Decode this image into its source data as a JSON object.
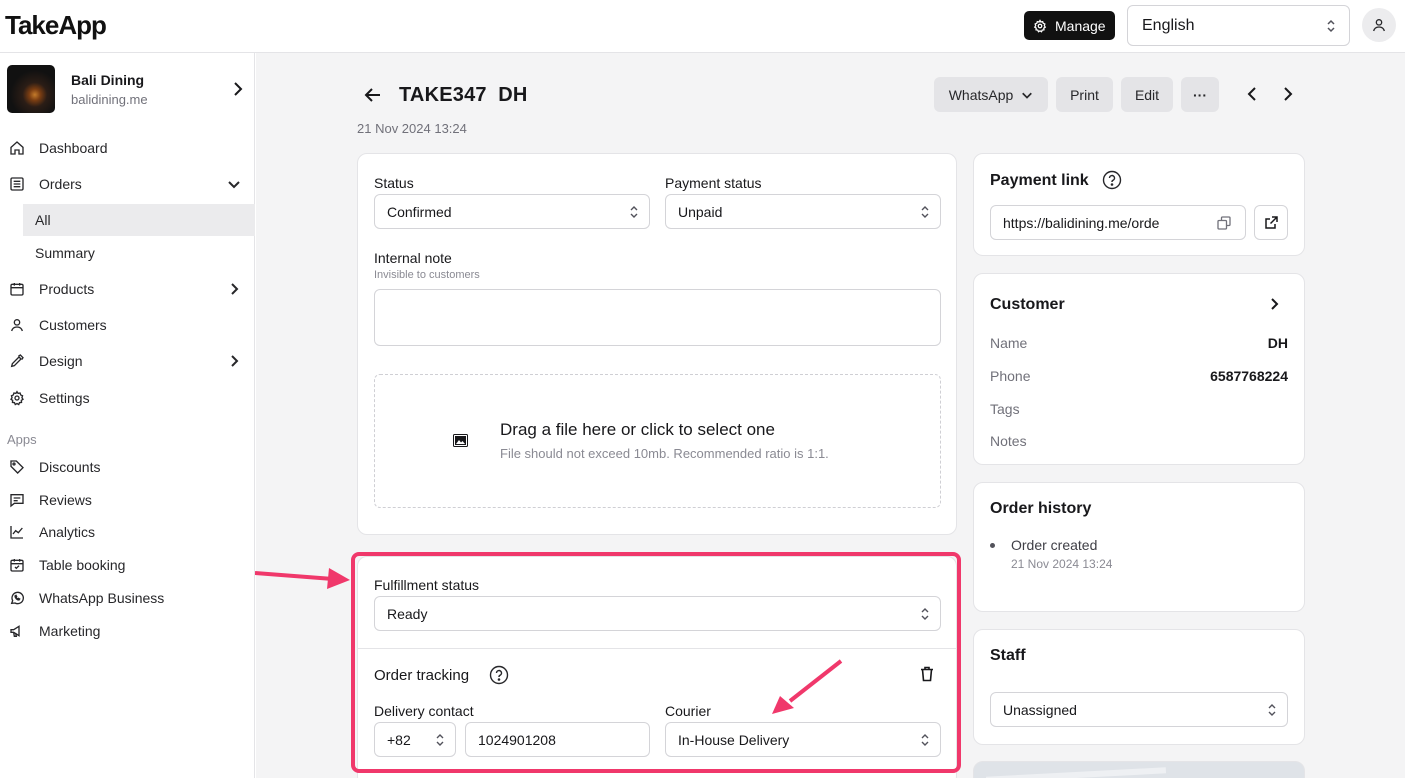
{
  "topbar": {
    "logo": "TakeApp",
    "manage_label": "Manage",
    "language": "English"
  },
  "sidebar": {
    "store_name": "Bali Dining",
    "store_domain": "balidining.me",
    "items": {
      "dashboard": "Dashboard",
      "orders": "Orders",
      "orders_all": "All",
      "orders_summary": "Summary",
      "products": "Products",
      "customers": "Customers",
      "design": "Design",
      "settings": "Settings"
    },
    "apps_label": "Apps",
    "apps": {
      "discounts": "Discounts",
      "reviews": "Reviews",
      "analytics": "Analytics",
      "table_booking": "Table booking",
      "whatsapp_business": "WhatsApp Business",
      "marketing": "Marketing"
    }
  },
  "order": {
    "id": "TAKE347",
    "customer_code": "DH",
    "date": "21 Nov 2024 13:24",
    "toolbar": {
      "whatsapp": "WhatsApp",
      "print": "Print",
      "edit": "Edit",
      "more": "···"
    }
  },
  "status_card": {
    "status_label": "Status",
    "status_value": "Confirmed",
    "payment_label": "Payment status",
    "payment_value": "Unpaid",
    "note_label": "Internal note",
    "note_hint": "Invisible to customers",
    "dropzone_title": "Drag a file here or click to select one",
    "dropzone_hint": "File should not exceed 10mb. Recommended ratio is 1:1."
  },
  "fulfillment_card": {
    "fulfillment_label": "Fulfillment status",
    "fulfillment_value": "Ready",
    "tracking_label": "Order tracking",
    "delivery_contact_label": "Delivery contact",
    "country_code": "+82",
    "phone": "1024901208",
    "courier_label": "Courier",
    "courier_value": "In-House Delivery"
  },
  "payment_link_card": {
    "title": "Payment link",
    "url": "https://balidining.me/orde"
  },
  "customer_card": {
    "title": "Customer",
    "name_label": "Name",
    "name_value": "DH",
    "phone_label": "Phone",
    "phone_value": "6587768224",
    "tags_label": "Tags",
    "notes_label": "Notes"
  },
  "history_card": {
    "title": "Order history",
    "event": "Order created",
    "event_time": "21 Nov 2024 13:24"
  },
  "staff_card": {
    "title": "Staff",
    "value": "Unassigned"
  },
  "colors": {
    "highlight": "#f0386b",
    "accent_dark": "#111111"
  }
}
